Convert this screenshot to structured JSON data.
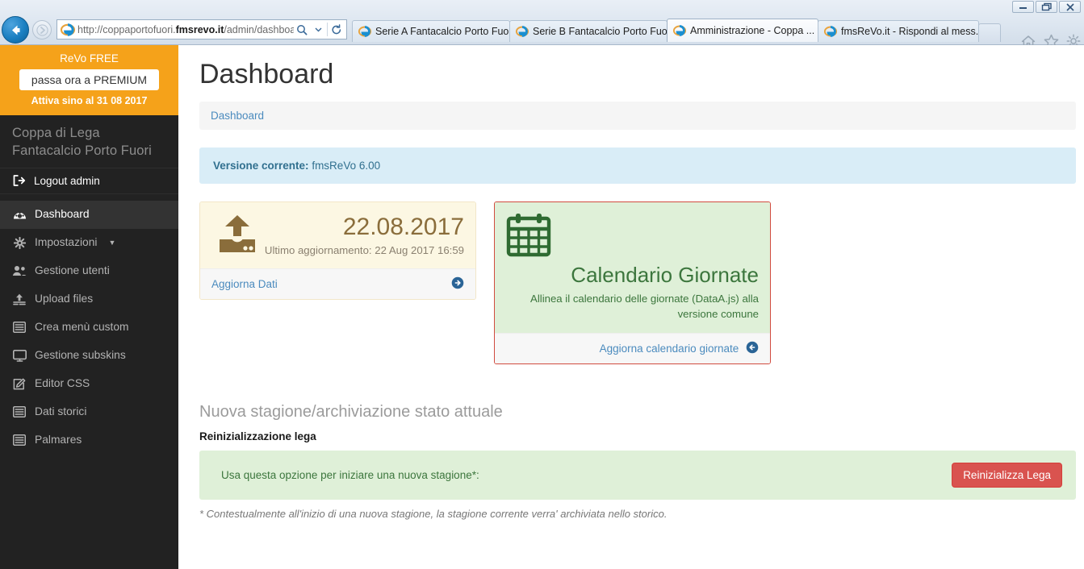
{
  "browser": {
    "url_prefix": "http://coppaportofuori.",
    "url_domain": "fmsrevo.it",
    "url_suffix": "/admin/dashboard.p",
    "back_icon": "back-arrow-icon",
    "forward_icon": "forward-arrow-icon",
    "search_icon": "search-icon",
    "dropdown_icon": "chevron-down-icon",
    "refresh_icon": "refresh-icon",
    "tabs": [
      {
        "title": "Serie A Fantacalcio Porto Fuori",
        "active": false,
        "closable": false
      },
      {
        "title": "Serie B Fantacalcio Porto Fuori",
        "active": false,
        "closable": false
      },
      {
        "title": "Amministrazione - Coppa ...",
        "active": true,
        "closable": true
      },
      {
        "title": "fmsReVo.it - Rispondi al mess...",
        "active": false,
        "closable": false
      }
    ],
    "close_label": "×",
    "tools": [
      "home-icon",
      "favorites-star-icon",
      "settings-gear-icon"
    ],
    "window_controls": [
      "minimize-icon",
      "restore-icon",
      "close-icon"
    ]
  },
  "sidebar": {
    "promo": {
      "plan_label": "ReVo FREE",
      "upgrade_button": "passa ora a PREMIUM",
      "expiry": "Attiva sino al 31 08 2017"
    },
    "league_name": "Coppa di Lega Fantacalcio Porto Fuori",
    "logout_label": "Logout admin",
    "logout_icon": "logout-icon",
    "items": [
      {
        "label": "Dashboard",
        "icon": "dashboard-icon",
        "active": true,
        "caret": false
      },
      {
        "label": "Impostazioni",
        "icon": "gear-icon",
        "active": false,
        "caret": true
      },
      {
        "label": "Gestione utenti",
        "icon": "users-icon",
        "active": false,
        "caret": false
      },
      {
        "label": "Upload files",
        "icon": "upload-icon",
        "active": false,
        "caret": false
      },
      {
        "label": "Crea menù custom",
        "icon": "list-icon",
        "active": false,
        "caret": false
      },
      {
        "label": "Gestione subskins",
        "icon": "desktop-icon",
        "active": false,
        "caret": false
      },
      {
        "label": "Editor CSS",
        "icon": "edit-square-icon",
        "active": false,
        "caret": false
      },
      {
        "label": "Dati storici",
        "icon": "list-icon",
        "active": false,
        "caret": false
      },
      {
        "label": "Palmares",
        "icon": "list-icon",
        "active": false,
        "caret": false
      }
    ],
    "caret_glyph": "▼"
  },
  "main": {
    "page_title": "Dashboard",
    "breadcrumb": "Dashboard",
    "version_alert": {
      "label": "Versione corrente:",
      "value": "fmsReVo 6.00"
    },
    "card_update": {
      "icon": "hdd-upload-icon",
      "big_date": "22.08.2017",
      "subtitle": "Ultimo aggiornamento: 22 Aug 2017 16:59",
      "footer_link": "Aggiorna Dati",
      "footer_icon": "arrow-circle-right-icon"
    },
    "card_calendar": {
      "icon": "calendar-icon",
      "title": "Calendario Giornate",
      "subtitle": "Allinea il calendario delle giornate (DataA.js) alla versione comune",
      "footer_link": "Aggiorna calendario giornate",
      "footer_icon": "arrow-circle-left-icon"
    },
    "reset": {
      "heading": "Nuova stagione/archiviazione stato attuale",
      "subheading": "Reinizializzazione lega",
      "panel_text": "Usa questa opzione per iniziare una nuova stagione*:",
      "button_label": "Reinizializza Lega",
      "note": "* Contestualmente all'inizio di una nuova stagione, la stagione corrente verra' archiviata nello storico."
    }
  },
  "colors": {
    "sidebar_bg": "#222222",
    "promo_orange": "#f5a21a",
    "link_blue": "#4b8bbe",
    "alert_info_bg": "#d9edf7",
    "alert_info_fg": "#31708f",
    "warning_bg": "#fcf7e3",
    "warning_fg": "#8a6d3b",
    "success_bg": "#dff0d8",
    "success_fg": "#3c763d",
    "danger_bg": "#d9534f",
    "danger_border": "#d14b3f"
  }
}
